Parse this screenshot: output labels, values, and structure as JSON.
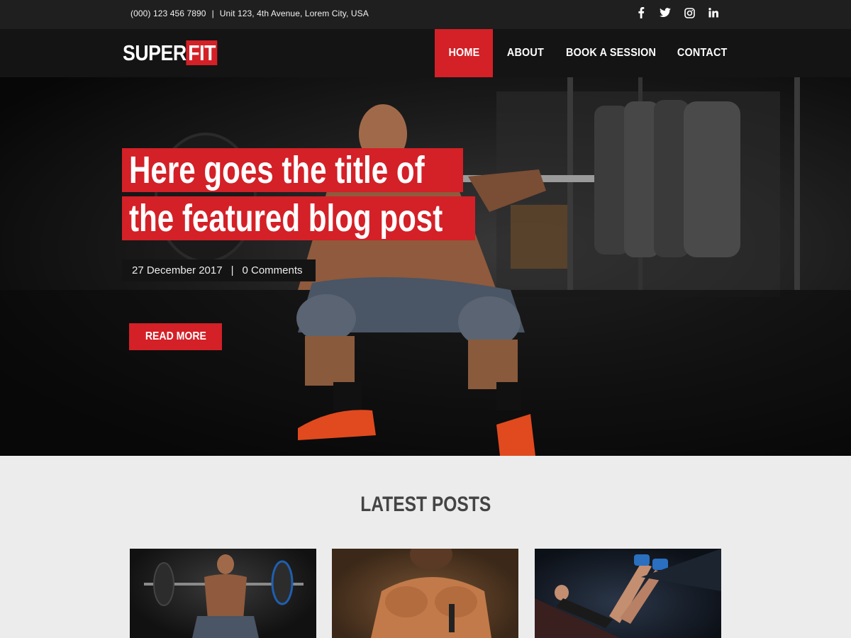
{
  "topbar": {
    "phone": "(000)  123 456 7890",
    "separator": "|",
    "address": "Unit 123, 4th Avenue, Lorem City, USA",
    "social_icons": [
      "facebook-icon",
      "twitter-icon",
      "instagram-icon",
      "linkedin-icon"
    ]
  },
  "brand": {
    "logo_part1": "SUPER",
    "logo_part2": "FIT",
    "accent": "#d42027"
  },
  "nav": {
    "items": [
      {
        "label": "HOME",
        "active": true
      },
      {
        "label": "ABOUT",
        "active": false
      },
      {
        "label": "BOOK A SESSION",
        "active": false
      },
      {
        "label": "CONTACT",
        "active": false
      }
    ]
  },
  "hero": {
    "title_line1": "Here goes the title of",
    "title_line2": "the featured blog post",
    "date": "27 December 2017",
    "meta_separator": "|",
    "comments": "0 Comments",
    "cta_label": "READ MORE"
  },
  "latest": {
    "heading": "LATEST POSTS"
  },
  "colors": {
    "topbar_bg": "#1f1f1f",
    "navbar_bg": "#141414",
    "section_bg": "#ececec",
    "heading_text": "#444444"
  }
}
